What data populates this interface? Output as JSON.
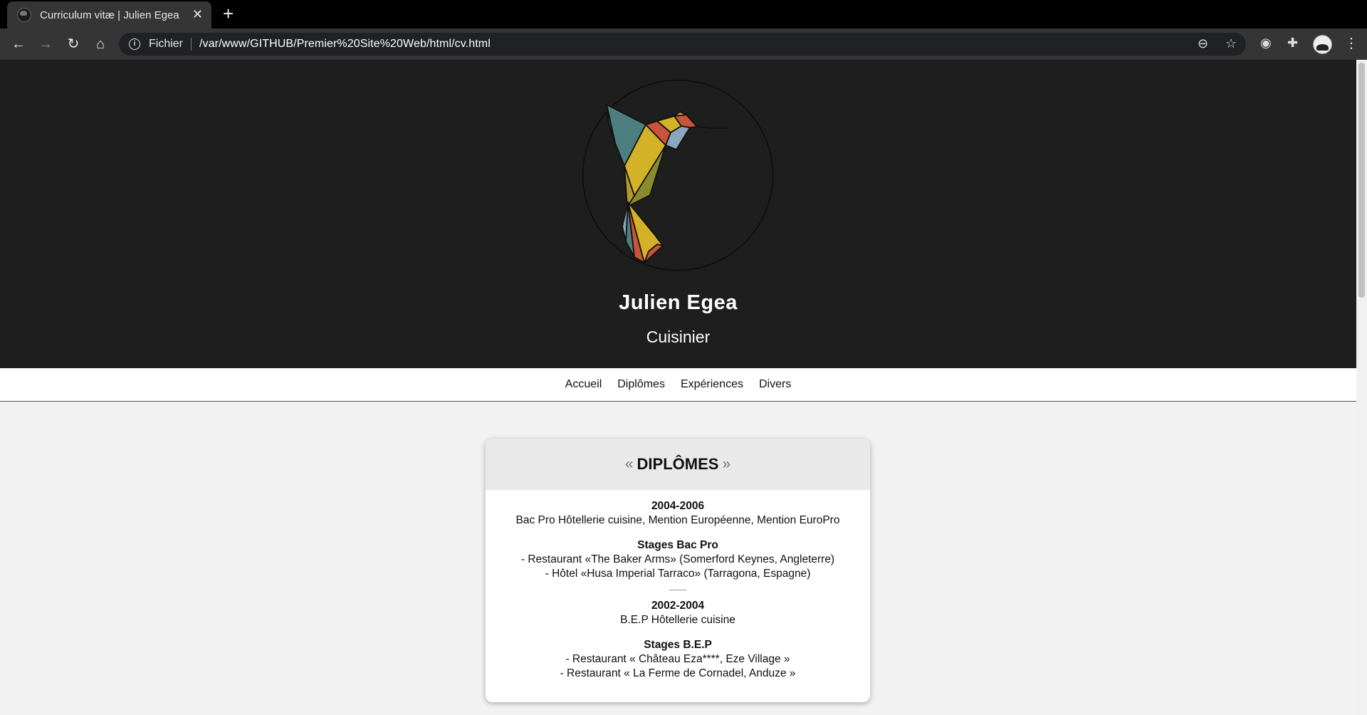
{
  "browser": {
    "tab_title": "Curriculum vitæ | Julien Egea",
    "tab_close": "✕",
    "new_tab": "+",
    "scheme_label": "Fichier",
    "url": "/var/www/GITHUB/Premier%20Site%20Web/html/cv.html",
    "icons": [
      "back-icon",
      "forward-icon",
      "reload-icon",
      "home-icon",
      "info-icon",
      "zoom-out-icon",
      "star-icon",
      "extension-icon",
      "puzzle-icon",
      "avatar",
      "menu-icon"
    ]
  },
  "header": {
    "name": "Julien Egea",
    "job": "Cuisinier",
    "background": "#1e1e1e"
  },
  "nav": {
    "items": [
      "Accueil",
      "Diplômes",
      "Expériences",
      "Divers"
    ]
  },
  "card": {
    "quote_open": "«",
    "title": "DIPLÔMES",
    "quote_close": "»",
    "entries": [
      {
        "period": "2004-2006",
        "diploma": "Bac Pro Hôtellerie cuisine, Mention Européenne, Mention EuroPro",
        "stages_title": "Stages Bac Pro",
        "stages": [
          "- Restaurant «The Baker Arms» (Somerford Keynes, Angleterre)",
          "- Hôtel «Husa Imperial Tarraco» (Tarragona, Espagne)"
        ]
      },
      {
        "period": "2002-2004",
        "diploma": "B.E.P Hôtellerie cuisine",
        "stages_title": "Stages B.E.P",
        "stages": [
          "- Restaurant « Château Eza****, Eze Village »",
          "- Restaurant « La Ferme de Cornadel, Anduze »"
        ]
      }
    ]
  },
  "colors": {
    "bird_teal": "#4e7f80",
    "bird_yellow": "#d3b228",
    "bird_olive": "#8a8a2e",
    "bird_red": "#c9533b",
    "bird_blue": "#8aa7bd"
  }
}
